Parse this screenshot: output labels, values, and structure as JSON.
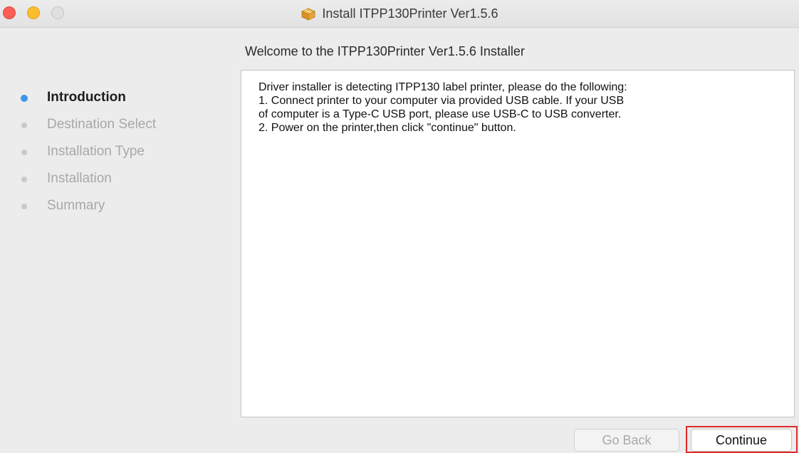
{
  "window": {
    "title": "Install ITPP130Printer Ver1.5.6",
    "title_icon": "package-icon"
  },
  "heading": "Welcome to the ITPP130Printer Ver1.5.6 Installer",
  "sidebar": {
    "items": [
      {
        "label": "Introduction",
        "active": true
      },
      {
        "label": "Destination Select",
        "active": false
      },
      {
        "label": "Installation Type",
        "active": false
      },
      {
        "label": "Installation",
        "active": false
      },
      {
        "label": "Summary",
        "active": false
      }
    ]
  },
  "content": {
    "lines": [
      "Driver installer is detecting ITPP130 label printer, please do the following:",
      "1. Connect printer to your computer via provided USB cable. If your USB",
      "of computer is a Type-C USB port, please use USB-C to USB converter.",
      "2. Power on the printer,then click \"continue\" button."
    ]
  },
  "buttons": {
    "back_label": "Go Back",
    "back_enabled": false,
    "continue_label": "Continue"
  },
  "colors": {
    "active_step": "#3e96e6",
    "highlight": "#e02a2a",
    "close": "#fc5f57",
    "minimize": "#fdbc2e"
  }
}
